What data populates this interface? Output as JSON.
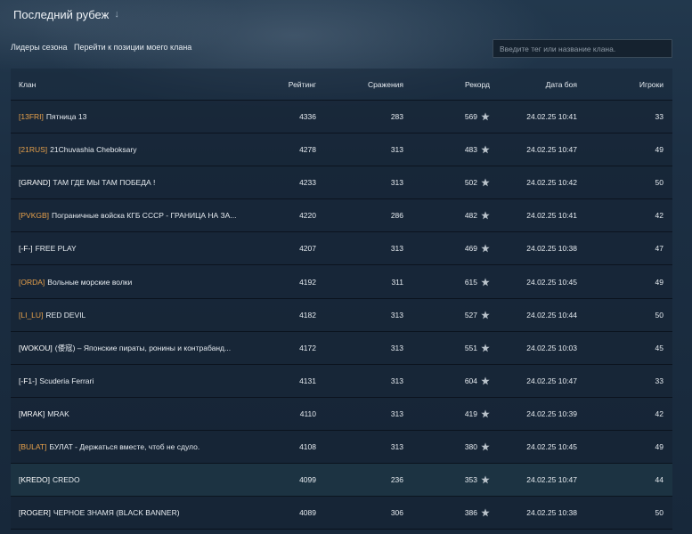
{
  "header": {
    "title": "Последний рубеж",
    "arrow_icon": "↓"
  },
  "toolbar": {
    "season_leaders": "Лидеры сезона",
    "go_to_my_clan": "Перейти к позиции моего клана",
    "search_placeholder": "Введите тег или название клана."
  },
  "columns": {
    "clan": "Клан",
    "rating": "Рейтинг",
    "battles": "Сражения",
    "record": "Рекорд",
    "date": "Дата боя",
    "players": "Игроки"
  },
  "colors": {
    "gold_tag": "#e8a14a",
    "white_tag": "#ffffff",
    "highlight_row": "#1c3442"
  },
  "rows": [
    {
      "tag": "[13FRI]",
      "tag_color": "gold",
      "name": "Пятница 13",
      "rating": "4336",
      "battles": "283",
      "record": "569",
      "date": "24.02.25 10:41",
      "players": "33"
    },
    {
      "tag": "[21RUS]",
      "tag_color": "gold",
      "name": "21Chuvashia Cheboksary",
      "rating": "4278",
      "battles": "313",
      "record": "483",
      "date": "24.02.25 10:47",
      "players": "49"
    },
    {
      "tag": "[GRAND]",
      "tag_color": "white",
      "name": "ТАМ ГДЕ МЫ ТАМ ПОБЕДА !",
      "rating": "4233",
      "battles": "313",
      "record": "502",
      "date": "24.02.25 10:42",
      "players": "50"
    },
    {
      "tag": "[PVKGB]",
      "tag_color": "gold",
      "name": "Пограничные войска КГБ СССР - ГРАНИЦА НА ЗА...",
      "rating": "4220",
      "battles": "286",
      "record": "482",
      "date": "24.02.25 10:41",
      "players": "42"
    },
    {
      "tag": "[-F-]",
      "tag_color": "white",
      "name": "FREE PLAY",
      "rating": "4207",
      "battles": "313",
      "record": "469",
      "date": "24.02.25 10:38",
      "players": "47"
    },
    {
      "tag": "[ORDA]",
      "tag_color": "gold",
      "name": "Вольные морские волки",
      "rating": "4192",
      "battles": "311",
      "record": "615",
      "date": "24.02.25 10:45",
      "players": "49"
    },
    {
      "tag": "[LI_LU]",
      "tag_color": "gold",
      "name": "RED DEVIL",
      "rating": "4182",
      "battles": "313",
      "record": "527",
      "date": "24.02.25 10:44",
      "players": "50"
    },
    {
      "tag": "[WOKOU]",
      "tag_color": "white",
      "name": "(倭寇) – Японские пираты, ронины и контрабанд...",
      "rating": "4172",
      "battles": "313",
      "record": "551",
      "date": "24.02.25 10:03",
      "players": "45"
    },
    {
      "tag": "[-F1-]",
      "tag_color": "white",
      "name": "Scuderia Ferrari",
      "rating": "4131",
      "battles": "313",
      "record": "604",
      "date": "24.02.25 10:47",
      "players": "33"
    },
    {
      "tag": "[MRAK]",
      "tag_color": "white",
      "name": "MRAK",
      "rating": "4110",
      "battles": "313",
      "record": "419",
      "date": "24.02.25 10:39",
      "players": "42"
    },
    {
      "tag": "[BULAT]",
      "tag_color": "gold",
      "name": "БУЛАТ - Держаться вместе, чтоб не сдуло.",
      "rating": "4108",
      "battles": "313",
      "record": "380",
      "date": "24.02.25 10:45",
      "players": "49"
    },
    {
      "tag": "[KREDO]",
      "tag_color": "white",
      "name": "CREDO",
      "rating": "4099",
      "battles": "236",
      "record": "353",
      "date": "24.02.25 10:47",
      "players": "44",
      "highlighted": true
    },
    {
      "tag": "[ROGER]",
      "tag_color": "white",
      "name": "ЧЕРНОЕ ЗНАМЯ (BLACK BANNER)",
      "rating": "4089",
      "battles": "306",
      "record": "386",
      "date": "24.02.25 10:38",
      "players": "50"
    }
  ]
}
